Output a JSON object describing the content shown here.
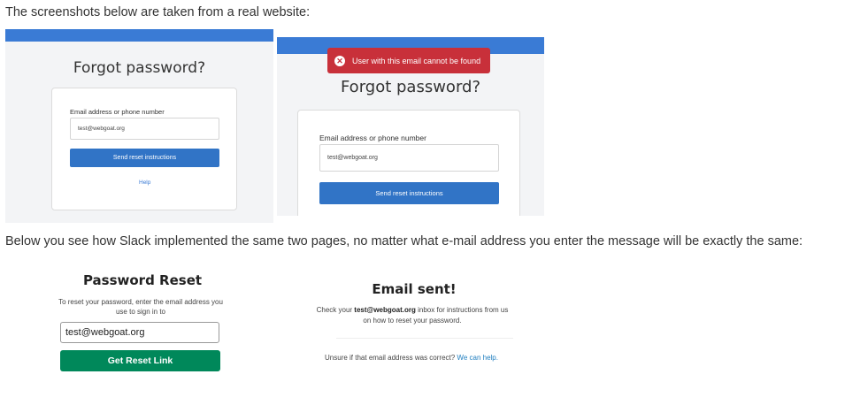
{
  "intro_text": "The screenshots below are taken from a real website:",
  "shot1": {
    "title": "Forgot password?",
    "field_label": "Email address or phone number",
    "field_value": "test@webgoat.org",
    "button": "Send reset instructions",
    "help_link": "Help"
  },
  "shot2": {
    "error_message": "User with this email cannot be found",
    "title": "Forgot password?",
    "field_label": "Email address or phone number",
    "field_value": "test@webgoat.org",
    "button": "Send reset instructions"
  },
  "slack_text": "Below you see how Slack implemented the same two pages, no matter what e-mail address you enter the message will be exactly the same:",
  "slack_reset": {
    "title": "Password Reset",
    "description": "To reset your password, enter the email address you use to sign in to",
    "input_value": "test@webgoat.org",
    "button": "Get Reset Link"
  },
  "slack_sent": {
    "title": "Email sent!",
    "desc_pre": "Check your ",
    "desc_email": "test@webgoat.org",
    "desc_post": " inbox for instructions from us on how to reset your password.",
    "foot_text": "Unsure if that email address was correct? ",
    "foot_link": "We can help."
  },
  "colors": {
    "brand_blue": "#3a7bd5",
    "button_blue": "#3174c6",
    "error_red": "#c8303a",
    "slack_green": "#00885a"
  },
  "icons": [
    "close-circle-icon",
    "mouse-cursor-icon"
  ]
}
